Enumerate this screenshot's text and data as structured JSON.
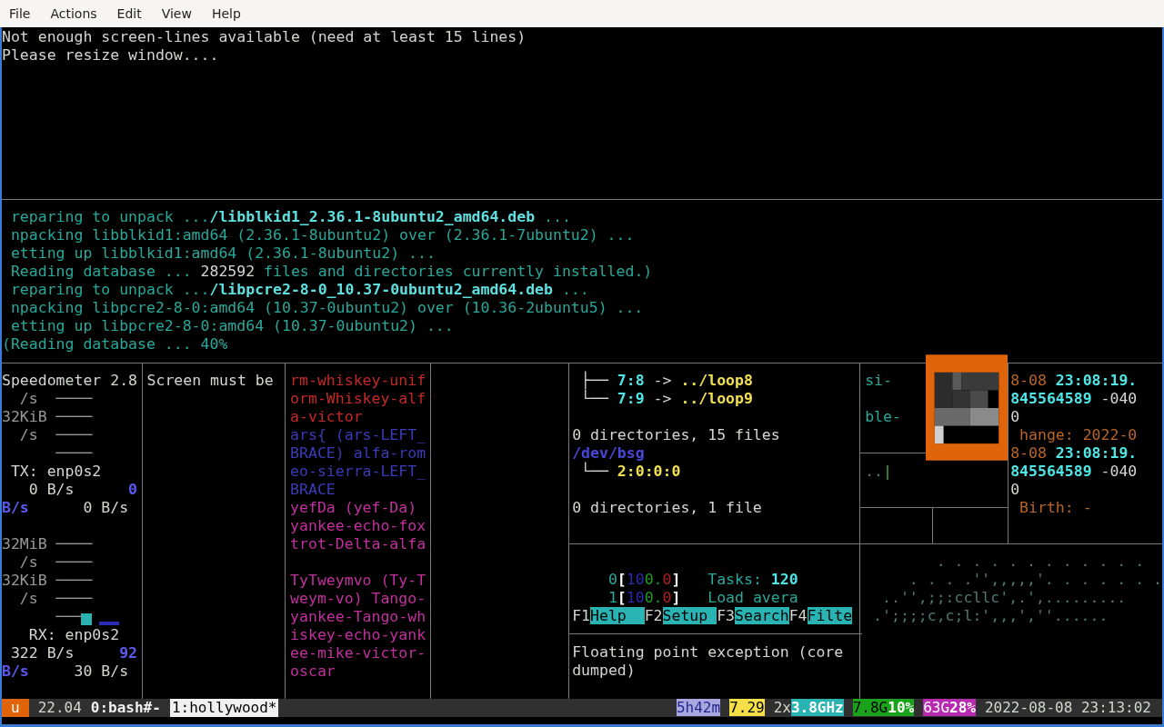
{
  "menu": [
    "File",
    "Actions",
    "Edit",
    "View",
    "Help"
  ],
  "message": {
    "rows": [
      [
        {
          "text": "Not enough screen-lines available (need at least 15 lines)",
          "kind": "plain"
        }
      ],
      [
        {
          "text": "Please resize window....",
          "kind": "plain"
        }
      ]
    ]
  },
  "apt_log": {
    "rows": [
      [
        {
          "text": " reparing to unpack ...",
          "kind": "teal"
        },
        {
          "text": "/libblkid1_2.36.1-8ubuntu2_amd64.deb",
          "kind": "path"
        },
        {
          "text": " ...",
          "kind": "teal"
        }
      ],
      [
        {
          "text": " npacking libblkid1:amd64 (2.36.1-8ubuntu2) over (2.36.1-7ubuntu2) ...",
          "kind": "teal"
        }
      ],
      [
        {
          "text": " etting up libblkid1:amd64 (2.36.1-8ubuntu2) ...",
          "kind": "teal"
        }
      ],
      [
        {
          "text": " Reading database ... ",
          "kind": "teal"
        },
        {
          "text": "282592",
          "kind": "plain"
        },
        {
          "text": " files and directories currently installed.)",
          "kind": "teal"
        }
      ],
      [
        {
          "text": " reparing to unpack ...",
          "kind": "teal"
        },
        {
          "text": "/libpcre2-8-0_10.37-0ubuntu2_amd64.deb",
          "kind": "path"
        },
        {
          "text": " ...",
          "kind": "teal"
        }
      ],
      [
        {
          "text": " npacking libpcre2-8-0:amd64 (10.37-0ubuntu2) over (10.36-2ubuntu5) ...",
          "kind": "teal"
        }
      ],
      [
        {
          "text": " etting up libpcre2-8-0:amd64 (10.37-0ubuntu2) ...",
          "kind": "teal"
        }
      ],
      [
        {
          "text": "(Reading database ... 40%",
          "kind": "teal"
        }
      ]
    ]
  },
  "speedometer": {
    "rows": [
      [
        {
          "text": "Speedometer 2.8",
          "kind": "plain"
        }
      ],
      [
        {
          "text": "  /s  ────",
          "kind": "gray"
        }
      ],
      [
        {
          "text": "32KiB ────",
          "kind": "gray"
        }
      ],
      [
        {
          "text": "  /s  ────",
          "kind": "gray"
        }
      ],
      [
        {
          "text": "      ────",
          "kind": "gray"
        }
      ],
      [
        {
          "text": " TX: enp0s2",
          "kind": "plain"
        }
      ],
      [
        {
          "text": "   0 B/s      ",
          "kind": "plain"
        },
        {
          "text": "0",
          "kind": "blue"
        }
      ],
      [
        {
          "text": "B/s",
          "kind": "blue"
        },
        {
          "text": "      0 B/s",
          "kind": "plain"
        }
      ],
      null,
      [
        {
          "text": "32MiB ────",
          "kind": "gray"
        }
      ],
      [
        {
          "text": "  /s  ────",
          "kind": "gray"
        }
      ],
      [
        {
          "text": "32KiB ────",
          "kind": "gray"
        }
      ],
      [
        {
          "text": "  /s  ────",
          "kind": "gray"
        }
      ],
      [
        {
          "text": "      ───",
          "kind": "gray"
        }
      ],
      [
        {
          "text": "   RX: enp0s2",
          "kind": "plain"
        }
      ],
      [
        {
          "text": " 322 B/s     ",
          "kind": "plain"
        },
        {
          "text": "92",
          "kind": "blue"
        }
      ],
      [
        {
          "text": "B/s",
          "kind": "blue"
        },
        {
          "text": "     30 B/s",
          "kind": "plain"
        }
      ]
    ]
  },
  "screen_notice": {
    "rows": [
      [
        {
          "text": "Screen must be",
          "kind": "plain"
        }
      ]
    ]
  },
  "word_stream": {
    "rows": [
      [
        {
          "text": "rm-whiskey-unif",
          "kind": "red"
        }
      ],
      [
        {
          "text": "orm-Whiskey-alf",
          "kind": "red"
        }
      ],
      [
        {
          "text": "a-victor",
          "kind": "red"
        }
      ],
      [
        {
          "text": "ars{ (ars-LEFT_",
          "kind": "indigo"
        }
      ],
      [
        {
          "text": "BRACE) alfa-rom",
          "kind": "indigo"
        }
      ],
      [
        {
          "text": "eo-sierra-LEFT_",
          "kind": "indigo"
        }
      ],
      [
        {
          "text": "BRACE",
          "kind": "indigo"
        }
      ],
      [
        {
          "text": "yefDa (yef-Da)",
          "kind": "magenta"
        }
      ],
      [
        {
          "text": "yankee-echo-fox",
          "kind": "magenta"
        }
      ],
      [
        {
          "text": "trot-Delta-alfa",
          "kind": "magenta"
        }
      ],
      null,
      [
        {
          "text": "TyTweymvo (Ty-T",
          "kind": "magenta"
        }
      ],
      [
        {
          "text": "weym-vo) Tango-",
          "kind": "magenta"
        }
      ],
      [
        {
          "text": "yankee-Tango-wh",
          "kind": "magenta"
        }
      ],
      [
        {
          "text": "iskey-echo-yank",
          "kind": "magenta"
        }
      ],
      [
        {
          "text": "ee-mike-victor-",
          "kind": "magenta"
        }
      ],
      [
        {
          "text": "oscar",
          "kind": "magenta"
        }
      ]
    ]
  },
  "tree": {
    "rows": [
      [
        {
          "text": " ├── ",
          "kind": "plain"
        },
        {
          "text": "7:8",
          "kind": "cyan"
        },
        {
          "text": " -> ",
          "kind": "plain"
        },
        {
          "text": "../loop8",
          "kind": "yellow"
        }
      ],
      [
        {
          "text": " └── ",
          "kind": "plain"
        },
        {
          "text": "7:9",
          "kind": "cyan"
        },
        {
          "text": " -> ",
          "kind": "plain"
        },
        {
          "text": "../loop9",
          "kind": "yellow"
        }
      ],
      null,
      [
        {
          "text": "0 directories, 15 files",
          "kind": "plain"
        }
      ],
      [
        {
          "text": "/dev/bsg",
          "kind": "dirblue"
        }
      ],
      [
        {
          "text": " └── ",
          "kind": "plain"
        },
        {
          "text": "2:0:0:0",
          "kind": "yellow"
        }
      ],
      null,
      [
        {
          "text": "0 directories, 1 file",
          "kind": "plain"
        }
      ]
    ]
  },
  "htop": {
    "rows": [
      null,
      [
        {
          "text": "    0",
          "kind": "teal"
        },
        {
          "text": "[",
          "kind": "bracket"
        },
        {
          "text": "10",
          "kind": "navy"
        },
        {
          "text": "0.",
          "kind": "lime"
        },
        {
          "text": "0",
          "kind": "crimson"
        },
        {
          "text": "]",
          "kind": "bracket"
        },
        {
          "text": "   Tasks: ",
          "kind": "teal"
        },
        {
          "text": "120",
          "kind": "cyan"
        }
      ],
      [
        {
          "text": "    1",
          "kind": "teal"
        },
        {
          "text": "[",
          "kind": "bracket"
        },
        {
          "text": "10",
          "kind": "navy"
        },
        {
          "text": "0.",
          "kind": "lime"
        },
        {
          "text": "0",
          "kind": "crimson"
        },
        {
          "text": "]",
          "kind": "bracket"
        },
        {
          "text": "   Load avera",
          "kind": "teal"
        }
      ]
    ],
    "function_keys": [
      {
        "key": "F1",
        "label": "Help  "
      },
      {
        "key": "F2",
        "label": "Setup "
      },
      {
        "key": "F3",
        "label": "Search"
      },
      {
        "key": "F4",
        "label": "Filte"
      }
    ]
  },
  "core_dump": {
    "rows": [
      [
        {
          "text": "Floating point exception (core",
          "kind": "plain"
        }
      ],
      [
        {
          "text": "dumped)",
          "kind": "plain"
        }
      ]
    ]
  },
  "file_browser": {
    "rows": [
      [
        {
          "text": "si-",
          "kind": "teal"
        }
      ],
      null,
      [
        {
          "text": "ble-",
          "kind": "teal"
        }
      ]
    ],
    "lower_rows": [
      [
        {
          "text": "..",
          "kind": "dim"
        },
        {
          "text": "|",
          "kind": "green"
        }
      ]
    ]
  },
  "stat": {
    "rows": [
      [
        {
          "text": "8-08 ",
          "kind": "orange"
        },
        {
          "text": "23:08:19.",
          "kind": "cyan"
        }
      ],
      [
        {
          "text": "845564589",
          "kind": "cyan"
        },
        {
          "text": " -040",
          "kind": "plain"
        }
      ],
      [
        {
          "text": "0",
          "kind": "plain"
        }
      ],
      [
        {
          "text": " hange: 2022-0",
          "kind": "orange"
        }
      ],
      [
        {
          "text": "8-08 ",
          "kind": "orange"
        },
        {
          "text": "23:08:19.",
          "kind": "cyan"
        }
      ],
      [
        {
          "text": "845564589",
          "kind": "cyan"
        },
        {
          "text": " -040",
          "kind": "plain"
        }
      ],
      [
        {
          "text": "0",
          "kind": "plain"
        }
      ],
      [
        {
          "text": " Birth: -",
          "kind": "orange"
        }
      ]
    ]
  },
  "ascii_art": {
    "rows": [
      [
        {
          "text": "        . . . . . . . . . . . .",
          "kind": "dim"
        }
      ],
      [
        {
          "text": "     . . . .'',,,,,'. . . . . . .",
          "kind": "dim"
        }
      ],
      [
        {
          "text": "  ..'',;;:ccllc',.',.........",
          "kind": "dim"
        }
      ],
      [
        {
          "text": " .';;;;c,c;l:',,,',''......",
          "kind": "dim"
        }
      ]
    ]
  },
  "status_bar": {
    "session": "u",
    "version": "22.04",
    "windows": [
      {
        "label": "0:bash#-",
        "selected": false
      },
      {
        "label": "1:hollywood*",
        "selected": true
      }
    ],
    "indicators": [
      [
        {
          "text": "5h42m",
          "kind": "lavender"
        }
      ],
      [
        {
          "text": "7.29",
          "kind": "amber"
        }
      ],
      [
        {
          "text": "2x",
          "kind": "plain"
        },
        {
          "text": "3.8GHz",
          "kind": "tealbg"
        }
      ],
      [
        {
          "text": "7.8G",
          "kind": "greenbg"
        },
        {
          "text": "10%",
          "kind": "greenbold"
        }
      ],
      [
        {
          "text": "63G",
          "kind": "magentabg"
        },
        {
          "text": "28%",
          "kind": "magentabold"
        }
      ],
      [
        {
          "text": "2022-08-08 23:13:02",
          "kind": "plain"
        }
      ]
    ]
  }
}
